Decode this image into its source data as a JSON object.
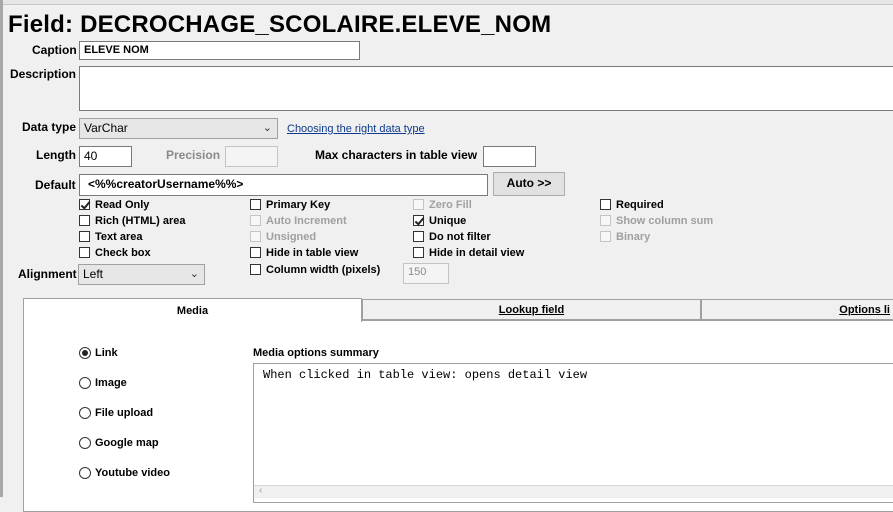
{
  "title": "Field: DECROCHAGE_SCOLAIRE.ELEVE_NOM",
  "caption": {
    "label": "Caption",
    "value": "ELEVE NOM"
  },
  "description": {
    "label": "Description",
    "value": ""
  },
  "data_type": {
    "label": "Data type",
    "value": "VarChar",
    "help_link": "Choosing the right data type"
  },
  "length": {
    "label": "Length",
    "value": "40"
  },
  "precision": {
    "label": "Precision",
    "value": ""
  },
  "max_chars": {
    "label": "Max characters in table view",
    "value": ""
  },
  "default": {
    "label": "Default",
    "value": "<%%creatorUsername%%>",
    "auto_button": "Auto >>"
  },
  "options": {
    "read_only": {
      "label": "Read Only",
      "checked": true
    },
    "rich_html": {
      "label": "Rich (HTML) area",
      "checked": false
    },
    "text_area": {
      "label": "Text area",
      "checked": false
    },
    "check_box": {
      "label": "Check box",
      "checked": false
    },
    "primary_key": {
      "label": "Primary Key",
      "checked": false
    },
    "auto_increment": {
      "label": "Auto Increment",
      "checked": false
    },
    "unsigned": {
      "label": "Unsigned",
      "checked": false
    },
    "hide_table": {
      "label": "Hide in table view",
      "checked": false
    },
    "zero_fill": {
      "label": "Zero Fill",
      "checked": false
    },
    "unique": {
      "label": "Unique",
      "checked": true
    },
    "not_filter": {
      "label": "Do not filter",
      "checked": false
    },
    "hide_detail": {
      "label": "Hide in detail view",
      "checked": false
    },
    "required": {
      "label": "Required",
      "checked": false
    },
    "show_sum": {
      "label": "Show column sum",
      "checked": false
    },
    "binary": {
      "label": "Binary",
      "checked": false
    },
    "col_width": {
      "label": "Column width (pixels)",
      "checked": false,
      "value": "150"
    }
  },
  "alignment": {
    "label": "Alignment",
    "value": "Left"
  },
  "tabs": [
    {
      "label": "Media"
    },
    {
      "label": "Lookup field"
    },
    {
      "label": "Options li"
    }
  ],
  "media": {
    "options": [
      "Link",
      "Image",
      "File upload",
      "Google map",
      "Youtube video"
    ],
    "selected": "Link",
    "summary_label": "Media options summary",
    "summary_text": "When clicked in table view: opens detail view"
  }
}
